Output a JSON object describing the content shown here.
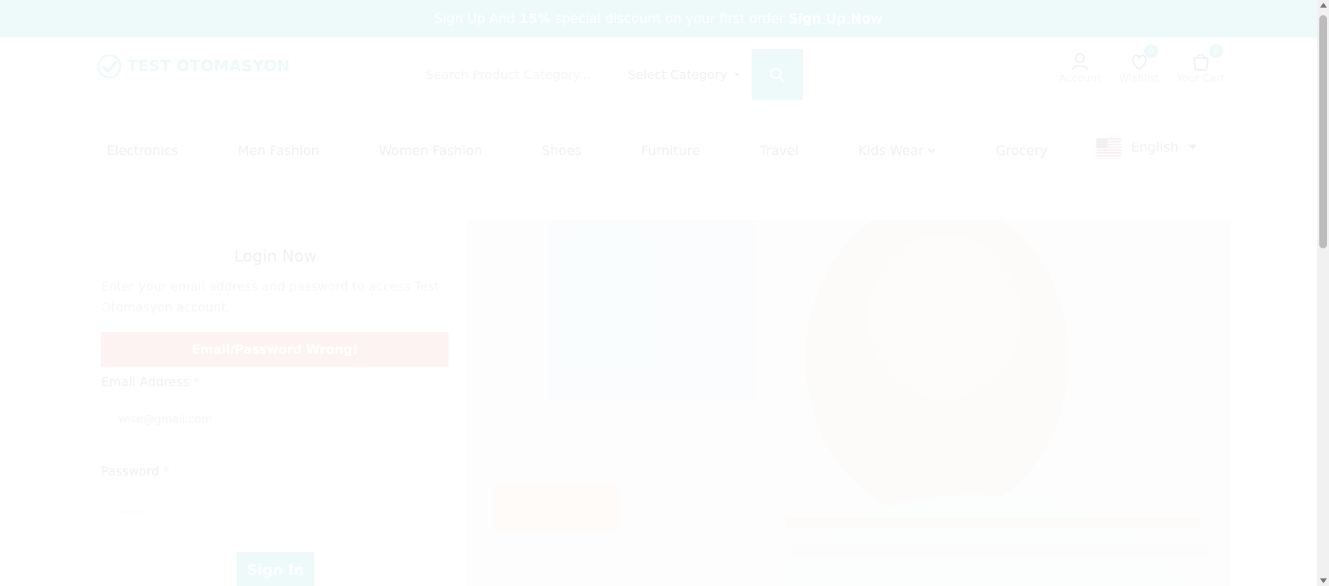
{
  "promo": {
    "pre": "Sign Up And",
    "highlight": "15%",
    "post": "special discount on your first order",
    "link": "Sign Up Now"
  },
  "header": {
    "logo_text": "TEST OTOMASYON",
    "search_placeholder": "Search Product Category...",
    "category_label": "Select Category",
    "account_label": "Account",
    "wishlist_label": "Wishlist",
    "wishlist_count": "0",
    "cart_label": "Your Cart",
    "cart_count": "0"
  },
  "nav": {
    "items": [
      "Electronics",
      "Men Fashion",
      "Women Fashion",
      "Shoes",
      "Furniture",
      "Travel",
      "Kids Wear",
      "Grocery"
    ],
    "language": "English"
  },
  "login": {
    "title": "Login Now",
    "description": "Enter your email address and password to access Test Otomasyon account.",
    "error": "Email/Password Wrong!",
    "email_label": "Email Address",
    "email_value": "wise@gmail.com",
    "password_label": "Password",
    "password_value": "........",
    "required_mark": "*",
    "submit": "Sign In"
  },
  "colors": {
    "accent": "#1aa6b7",
    "error": "#e0544b"
  }
}
